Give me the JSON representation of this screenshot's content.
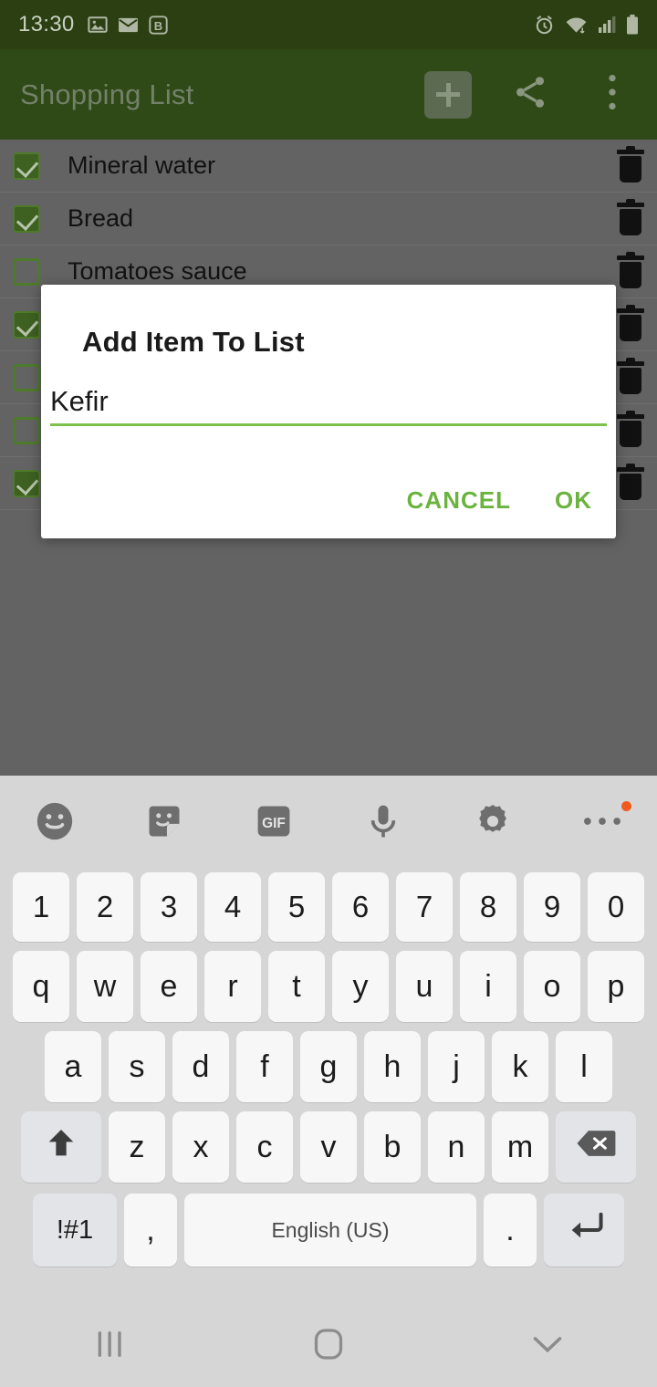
{
  "status_bar": {
    "clock": "13:30",
    "left_icons": [
      "gallery-icon",
      "email-icon",
      "bold-b-icon"
    ],
    "right_icons": [
      "alarm-icon",
      "wifi-icon",
      "signal-icon",
      "battery-icon"
    ],
    "background_color": "#2B3F12",
    "text_color": "#CBD0C2"
  },
  "app_bar": {
    "title": "Shopping List",
    "background_color": "#2F4A16",
    "title_color": "#73816A",
    "actions": [
      {
        "name": "add-item-button",
        "icon": "plus-icon"
      },
      {
        "name": "share-button",
        "icon": "share-icon"
      },
      {
        "name": "overflow-menu-button",
        "icon": "more-vertical-icon"
      }
    ]
  },
  "list": {
    "background_color": "#636363",
    "checkbox_color": "#4E7B2A",
    "items": [
      {
        "label": "Mineral water",
        "checked": true
      },
      {
        "label": "Bread",
        "checked": true
      },
      {
        "label": "Tomatoes sauce",
        "checked": false
      },
      {
        "label": "",
        "checked": true
      },
      {
        "label": "",
        "checked": false
      },
      {
        "label": "",
        "checked": false
      },
      {
        "label": "",
        "checked": true
      }
    ],
    "delete_icon": "trash-icon"
  },
  "dialog": {
    "title": "Add Item To List",
    "input_value": "Kefir",
    "input_placeholder": "",
    "accent_color": "#7CC24C",
    "cancel_label": "CANCEL",
    "ok_label": "OK",
    "button_color": "#6BB33F"
  },
  "keyboard": {
    "background_color": "#D6D6D6",
    "key_color": "#F7F7F7",
    "toolbar": [
      {
        "name": "emoji-icon"
      },
      {
        "name": "sticker-icon"
      },
      {
        "name": "gif-icon",
        "label": "GIF"
      },
      {
        "name": "microphone-icon"
      },
      {
        "name": "gear-icon"
      },
      {
        "name": "more-horizontal-icon",
        "badge_color": "#F05A1E"
      }
    ],
    "rows": {
      "numbers": [
        "1",
        "2",
        "3",
        "4",
        "5",
        "6",
        "7",
        "8",
        "9",
        "0"
      ],
      "row1": [
        "q",
        "w",
        "e",
        "r",
        "t",
        "y",
        "u",
        "i",
        "o",
        "p"
      ],
      "row2": [
        "a",
        "s",
        "d",
        "f",
        "g",
        "h",
        "j",
        "k",
        "l"
      ],
      "row3": [
        "z",
        "x",
        "c",
        "v",
        "b",
        "n",
        "m"
      ],
      "shift_key": "shift-icon",
      "backspace_key": "backspace-icon",
      "symbols_key": "!#1",
      "comma_key": ",",
      "space_key": "English (US)",
      "period_key": ".",
      "enter_key": "enter-icon"
    }
  },
  "nav_bar": {
    "background_color": "#D6D6D6",
    "buttons": [
      {
        "name": "recents-button",
        "icon": "recents-icon"
      },
      {
        "name": "home-button",
        "icon": "home-icon"
      },
      {
        "name": "hide-keyboard-button",
        "icon": "chevron-down-icon"
      }
    ]
  }
}
